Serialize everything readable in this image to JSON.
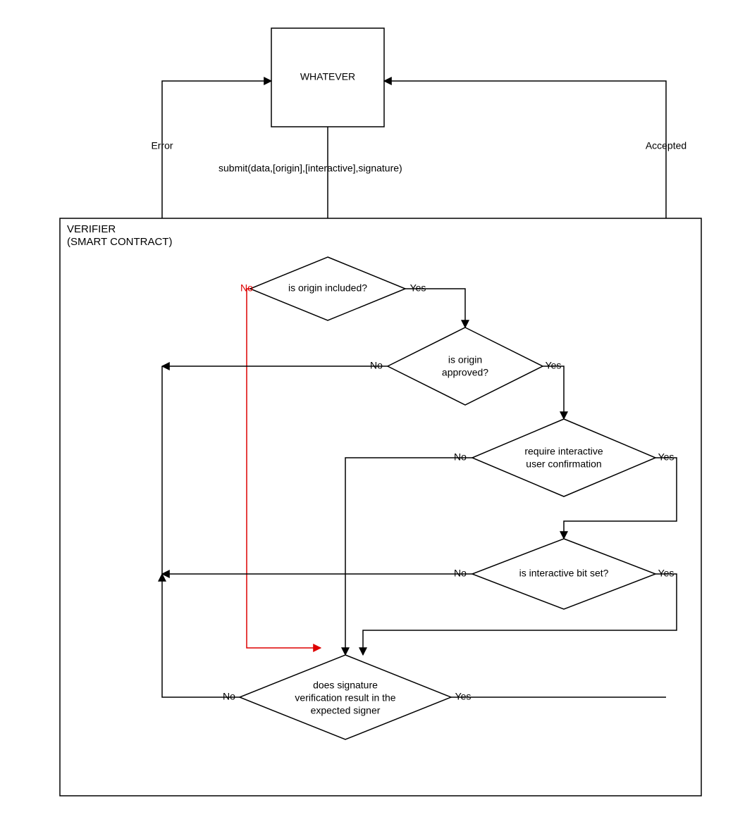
{
  "top_box": "WHATEVER",
  "submit_label": "submit(data,[origin],[interactive],signature)",
  "error_label": "Error",
  "accepted_label": "Accepted",
  "verifier_title1": "VERIFIER",
  "verifier_title2": "(SMART CONTRACT)",
  "decisions": {
    "origin_included": "is origin included?",
    "origin_approved_l1": "is origin",
    "origin_approved_l2": "approved?",
    "require_interactive_l1": "require interactive",
    "require_interactive_l2": "user confirmation",
    "interactive_bit": "is interactive bit set?",
    "sig_l1": "does signature",
    "sig_l2": "verification result in the",
    "sig_l3": "expected signer"
  },
  "labels": {
    "yes": "Yes",
    "no": "No"
  }
}
